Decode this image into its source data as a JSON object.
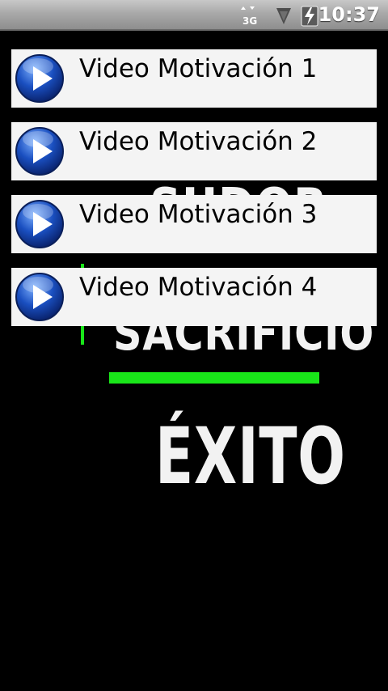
{
  "status_bar": {
    "network_type": "3G",
    "time": "10:37",
    "icons": [
      "network-3g-icon",
      "signal-icon",
      "battery-charging-icon"
    ]
  },
  "background": {
    "words": [
      "SUDOR",
      "SACRIFICIO",
      "ÉXITO"
    ],
    "accent_color": "#19e619"
  },
  "videos": [
    {
      "label": "Video Motivación 1",
      "icon": "play-icon"
    },
    {
      "label": "Video Motivación 2",
      "icon": "play-icon"
    },
    {
      "label": "Video Motivación 3",
      "icon": "play-icon"
    },
    {
      "label": "Video Motivación 4",
      "icon": "play-icon"
    }
  ],
  "colors": {
    "list_item_bg": "#f4f4f4",
    "play_blue": "#1a4fc0"
  }
}
